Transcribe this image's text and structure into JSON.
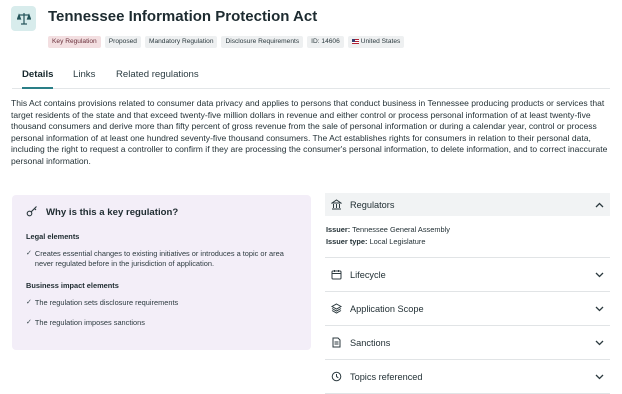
{
  "header": {
    "icon": "scales-icon",
    "title": "Tennessee Information Protection Act",
    "tags": [
      "Key Regulation",
      "Proposed",
      "Mandatory Regulation",
      "Disclosure Requirements",
      "ID: 14606",
      "United States"
    ],
    "colors": {
      "icon_bg": "#d8ecec",
      "key_tag_bg": "#f3dfe1",
      "tab_accent": "#2a7f87"
    }
  },
  "tabs": [
    {
      "label": "Details",
      "active": true
    },
    {
      "label": "Links",
      "active": false
    },
    {
      "label": "Related regulations",
      "active": false
    }
  ],
  "description": "This Act contains provisions related to consumer data privacy and applies to persons that conduct business in Tennessee producing products or services that target residents of the state and that exceed twenty-five million dollars in revenue and either control or process personal information of at least twenty-five thousand consumers and derive more than fifty percent of gross revenue from the sale of personal information or during a calendar year, control or process personal information of at least one hundred seventy-five thousand consumers. The Act establishes rights for consumers in relation to their personal data, including the right to request a controller to confirm if they are processing the consumer's personal information, to delete information, and to correct inaccurate personal information.",
  "key_panel": {
    "icon": "key-icon",
    "heading": "Why is this a key regulation?",
    "legal_label": "Legal elements",
    "legal_items": [
      "Creates essential changes to existing initiatives or introduces a topic or area never regulated before in the jurisdiction of application."
    ],
    "business_label": "Business impact elements",
    "business_items": [
      "The regulation sets disclosure requirements",
      "The regulation imposes sanctions"
    ],
    "colors": {
      "panel_bg": "#f3eef8"
    }
  },
  "accordion": {
    "regulators": {
      "label": "Regulators",
      "icon": "bank-icon",
      "expanded": true,
      "issuer_label": "Issuer:",
      "issuer_value": "Tennessee General Assembly",
      "issuer_type_label": "Issuer type:",
      "issuer_type_value": "Local Legislature"
    },
    "sections": [
      {
        "label": "Lifecycle",
        "icon": "calendar-icon"
      },
      {
        "label": "Application Scope",
        "icon": "layers-icon"
      },
      {
        "label": "Sanctions",
        "icon": "document-icon"
      },
      {
        "label": "Topics referenced",
        "icon": "clock-icon"
      }
    ]
  }
}
